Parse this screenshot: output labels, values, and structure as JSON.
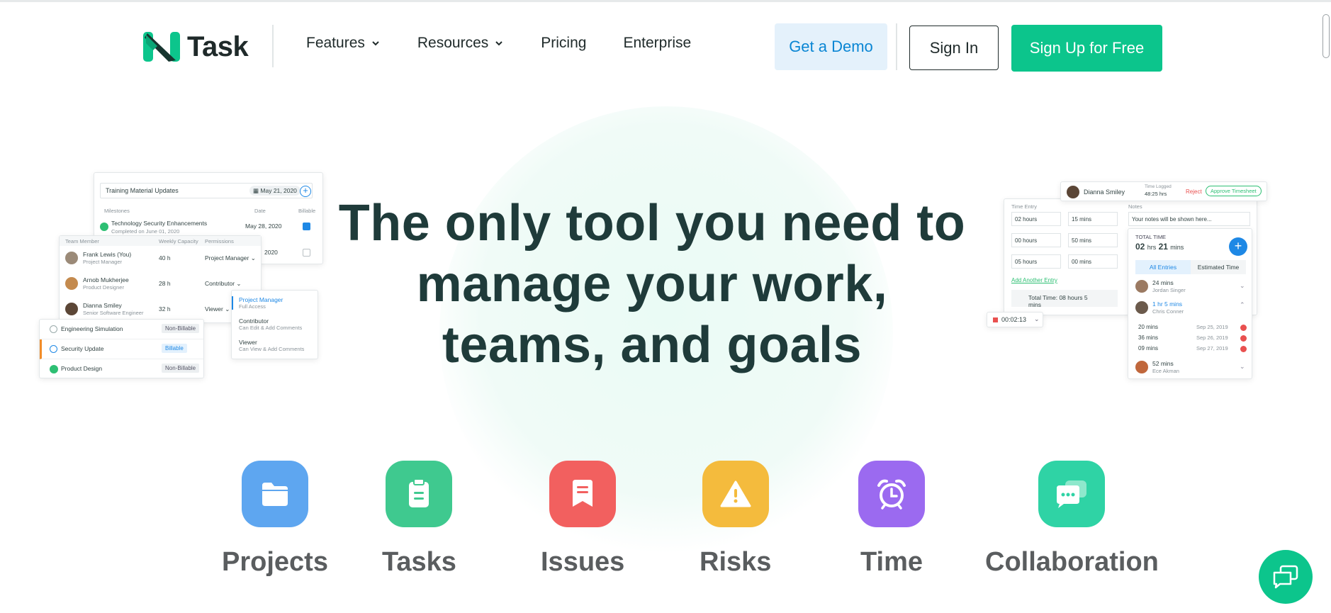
{
  "header": {
    "logo_text": "Task",
    "nav": [
      {
        "label": "Features",
        "has_dropdown": true
      },
      {
        "label": "Resources",
        "has_dropdown": true
      },
      {
        "label": "Pricing",
        "has_dropdown": false
      },
      {
        "label": "Enterprise",
        "has_dropdown": false
      }
    ],
    "demo_label": "Get a Demo",
    "signin_label": "Sign In",
    "signup_label": "Sign Up for Free"
  },
  "hero": {
    "line1": "The only tool you need to",
    "line2": "manage your work,",
    "line3": "teams, and goals"
  },
  "left_mockup": {
    "task_input": "Training Material Updates",
    "task_date": "May 21, 2020",
    "milestones_header": "Milestones",
    "date_header": "Date",
    "billable_header": "Billable",
    "milestone_name": "Technology Security Enhancements",
    "milestone_sub": "Completed on June 01, 2020",
    "milestone_date": "May 28, 2020",
    "milestone_date2": "2020",
    "team_headers": [
      "Team Member",
      "Weekly Capacity",
      "Permissions"
    ],
    "team": [
      {
        "name": "Frank Lewis (You)",
        "role": "Project Manager",
        "capacity": "40 h",
        "permission": "Project Manager"
      },
      {
        "name": "Arnob Mukherjee",
        "role": "Product Designer",
        "capacity": "28 h",
        "permission": "Contributor"
      },
      {
        "name": "Dianna Smiley",
        "role": "Senior Software Engineer",
        "capacity": "32 h",
        "permission": "Viewer"
      }
    ],
    "perm_options": [
      {
        "title": "Project Manager",
        "desc": "Full Access"
      },
      {
        "title": "Contributor",
        "desc": "Can Edit & Add Comments"
      },
      {
        "title": "Viewer",
        "desc": "Can View & Add Comments"
      }
    ],
    "tasks": [
      {
        "name": "Engineering Simulation",
        "tag": "Non-Billable"
      },
      {
        "name": "Security Update",
        "tag": "Billable"
      },
      {
        "name": "Product Design",
        "tag": "Non-Billable"
      }
    ]
  },
  "right_mockup": {
    "user": "Dianna Smiley",
    "time_logged_label": "Time Logged",
    "time_logged": "48:25 hrs",
    "reject": "Reject",
    "approve": "Approve Timesheet",
    "time_entry_header": "Time Entry",
    "notes_header": "Notes",
    "notes_placeholder": "Your notes will be shown here...",
    "rows": [
      {
        "hours": "02 hours",
        "mins": "15 mins"
      },
      {
        "hours": "00 hours",
        "mins": "50 mins"
      },
      {
        "hours": "05 hours",
        "mins": "00 mins"
      }
    ],
    "add_entry": "Add Another Entry",
    "total_time_text": "Total Time: 08 hours 5 mins",
    "timer": "00:02:13",
    "total_time_label": "TOTAL TIME",
    "total_hrs": "02",
    "hrs": "hrs",
    "total_mins": "21",
    "mins": "mins",
    "tab_all": "All Entries",
    "tab_est": "Estimated Time",
    "entries": [
      {
        "dur": "24 mins",
        "name": "Jordan Singer"
      },
      {
        "dur": "1 hr 5 mins",
        "name": "Chris Conner"
      }
    ],
    "sub_entries": [
      {
        "dur": "20 mins",
        "date": "Sep 25, 2019"
      },
      {
        "dur": "36 mins",
        "date": "Sep 26, 2019"
      },
      {
        "dur": "09 mins",
        "date": "Sep 27, 2019"
      }
    ],
    "last_entry": {
      "dur": "52 mins",
      "name": "Ece Akman"
    }
  },
  "features": [
    {
      "label": "Projects",
      "color": "#5ea6f0",
      "icon": "folder-icon"
    },
    {
      "label": "Tasks",
      "color": "#3fc98f",
      "icon": "clipboard-icon"
    },
    {
      "label": "Issues",
      "color": "#f2605f",
      "icon": "bookmark-note-icon"
    },
    {
      "label": "Risks",
      "color": "#f4bb3d",
      "icon": "warning-icon"
    },
    {
      "label": "Time",
      "color": "#9b6af0",
      "icon": "alarm-clock-icon"
    },
    {
      "label": "Collaboration",
      "color": "#2fd3a5",
      "icon": "chat-bubbles-icon"
    }
  ],
  "colors": {
    "brand_green": "#0cc58c",
    "heading": "#1f3b3a",
    "link_blue": "#0a86d4"
  }
}
